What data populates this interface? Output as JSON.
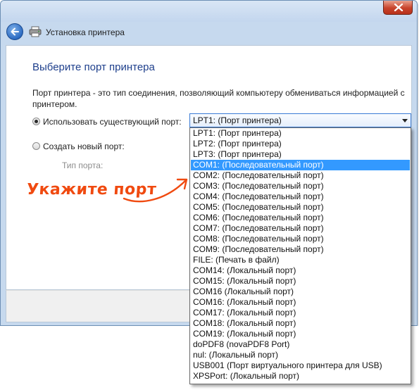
{
  "window": {
    "nav_title": "Установка принтера"
  },
  "page": {
    "heading": "Выберите порт принтера",
    "description": "Порт принтера - это тип соединения, позволяющий компьютеру обмениваться информацией с принтером.",
    "use_existing_label": "Использовать существующий порт:",
    "create_new_label": "Создать новый порт:",
    "port_type_label": "Тип порта:"
  },
  "select": {
    "value": "LPT1: (Порт принтера)",
    "options": [
      "LPT1: (Порт принтера)",
      "LPT2: (Порт принтера)",
      "LPT3: (Порт принтера)",
      "COM1: (Последовательный порт)",
      "COM2: (Последовательный порт)",
      "COM3: (Последовательный порт)",
      "COM4: (Последовательный порт)",
      "COM5: (Последовательный порт)",
      "COM6: (Последовательный порт)",
      "COM7: (Последовательный порт)",
      "COM8: (Последовательный порт)",
      "COM9: (Последовательный порт)",
      "FILE: (Печать в файл)",
      "COM14: (Локальный порт)",
      "COM15: (Локальный порт)",
      "COM16 (Локальный порт)",
      "COM16: (Локальный порт)",
      "COM17: (Локальный порт)",
      "COM18: (Локальный порт)",
      "COM19: (Локальный порт)",
      "doPDF8 (novaPDF8 Port)",
      "nul: (Локальный порт)",
      "USB001 (Порт виртуального принтера для USB)",
      "XPSPort: (Локальный порт)"
    ],
    "highlighted_option": "COM1: (Последовательный порт)"
  },
  "annotation": {
    "text": "Укажите порт"
  },
  "colors": {
    "heading": "#1e3f8c",
    "selection": "#3399ff",
    "annotation": "#f04a10"
  },
  "icons": {
    "back": "back-arrow-icon",
    "printer": "printer-icon",
    "close": "close-icon",
    "dropdown": "chevron-down-icon"
  }
}
